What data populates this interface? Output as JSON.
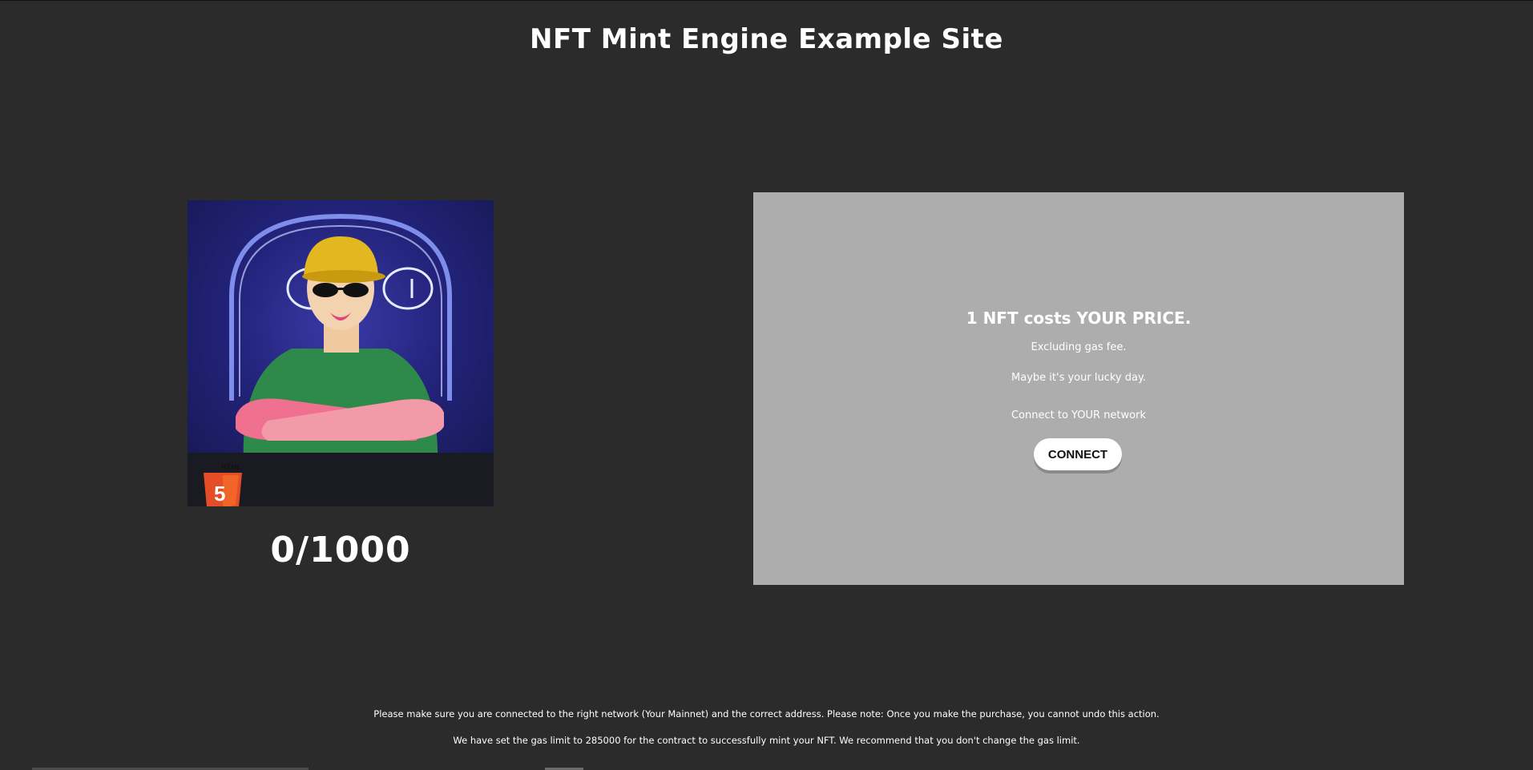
{
  "header": {
    "title": "NFT Mint Engine Example Site"
  },
  "showcase": {
    "image_icon": "html5-badge",
    "counter": "0/1000"
  },
  "mint_panel": {
    "price_text": "1 NFT costs YOUR PRICE.",
    "gas_text": "Excluding gas fee.",
    "lucky_text": "Maybe it's your lucky day.",
    "network_text": "Connect to YOUR network",
    "connect_label": "CONNECT"
  },
  "footer": {
    "notice_network": "Please make sure you are connected to the right network (Your Mainnet) and the correct address. Please note: Once you make the purchase, you cannot undo this action.",
    "notice_gas": "We have set the gas limit to 285000 for the contract to successfully mint your NFT. We recommend that you don't change the gas limit."
  },
  "colors": {
    "background": "#2b2b2b",
    "panel": "#adadad",
    "button": "#ffffff"
  }
}
